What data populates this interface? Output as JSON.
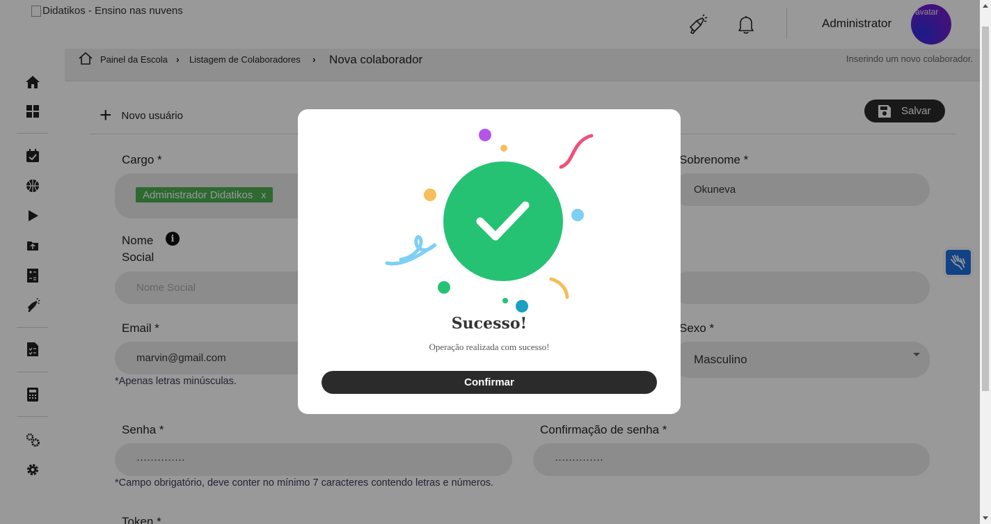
{
  "header": {
    "logo_alt": "Didatikos - Ensino nas nuvens",
    "admin_name": "Administrator",
    "avatar_alt": "avatar",
    "icons": [
      "megaphone-icon",
      "bell-icon"
    ]
  },
  "sidebar": {
    "items": [
      "home-icon",
      "dashboard-icon",
      "calendar-check-icon",
      "basketball-icon",
      "play-icon",
      "folder-upload-icon",
      "math-worksheet-icon",
      "megaphone-icon",
      "checklist-document-icon",
      "calculator-icon",
      "gears-icon",
      "settings-icon"
    ]
  },
  "breadcrumb": {
    "items": [
      "Painel da Escola",
      "Listagem de Colaboradores"
    ],
    "current": "Nova colaborador",
    "separator": "›",
    "note": "Inserindo um novo colaborador."
  },
  "form": {
    "section_title": "Novo usuário",
    "save_label": "Salvar",
    "cargo_label": "Cargo *",
    "cargo_tag": "Administrador Didatikos",
    "cargo_tag_remove": "x",
    "sobrenome_label": "Sobrenome *",
    "sobrenome_value": "Okuneva",
    "nome_social_label_1": "Nome",
    "nome_social_label_2": "Social",
    "nome_social_info": "i",
    "nome_social_placeholder": "Nome Social",
    "email_label": "Email *",
    "email_value": "marvin@gmail.com",
    "email_hint": "*Apenas letras minúsculas.",
    "sexo_label": "Sexo *",
    "sexo_value": "Masculino",
    "senha_label": "Senha *",
    "senha_value": "··············",
    "confirm_senha_label": "Confirmação de senha *",
    "confirm_senha_value": "··············",
    "senha_hint": "*Campo obrigatório, deve conter no mínimo 7 caracteres contendo letras e números.",
    "token_label": "Token *"
  },
  "modal": {
    "title": "Sucesso!",
    "message": "Operação realizada com sucesso!",
    "confirm_label": "Confirmar",
    "success_color": "#25c274"
  },
  "colors": {
    "dark_button": "#2b2b2b",
    "tag_green": "#4caf50",
    "accessibility_blue": "#1f6fe0"
  }
}
